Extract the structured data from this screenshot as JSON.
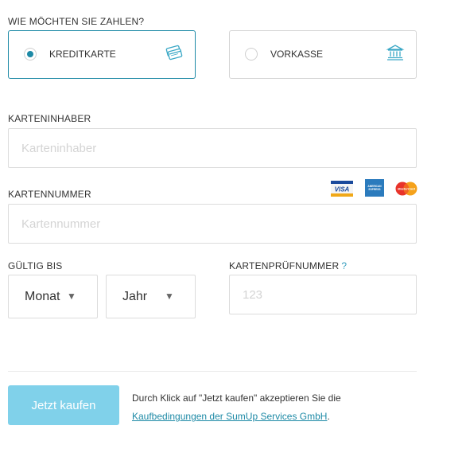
{
  "payment": {
    "heading": "WIE MÖCHTEN SIE ZAHLEN?",
    "options": [
      {
        "label": "KREDITKARTE",
        "selected": true,
        "icon": "credit-cards-icon"
      },
      {
        "label": "VORKASSE",
        "selected": false,
        "icon": "bank-icon"
      }
    ]
  },
  "holder": {
    "label": "KARTENINHABER",
    "placeholder": "Karteninhaber",
    "value": ""
  },
  "number": {
    "label": "KARTENNUMMER",
    "placeholder": "Kartennummer",
    "value": ""
  },
  "card_logos": {
    "visa": "VISA",
    "amex": [
      "AMERICAN",
      "EXPRESS"
    ],
    "mastercard": "MasterCard"
  },
  "expiry": {
    "label": "GÜLTIG BIS",
    "month": "Monat",
    "year": "Jahr"
  },
  "cvc": {
    "label": "KARTENPRÜFNUMMER",
    "help": "?",
    "placeholder": "123",
    "value": ""
  },
  "submit": {
    "label": "Jetzt kaufen"
  },
  "terms": {
    "text": "Durch Klick auf \"Jetzt kaufen\" akzeptieren Sie die",
    "link": "Kaufbedingungen der SumUp Services GmbH",
    "suffix": "."
  },
  "colors": {
    "accent": "#1e8aa6",
    "button": "#80d1ea",
    "border": "#dcdcdc"
  }
}
